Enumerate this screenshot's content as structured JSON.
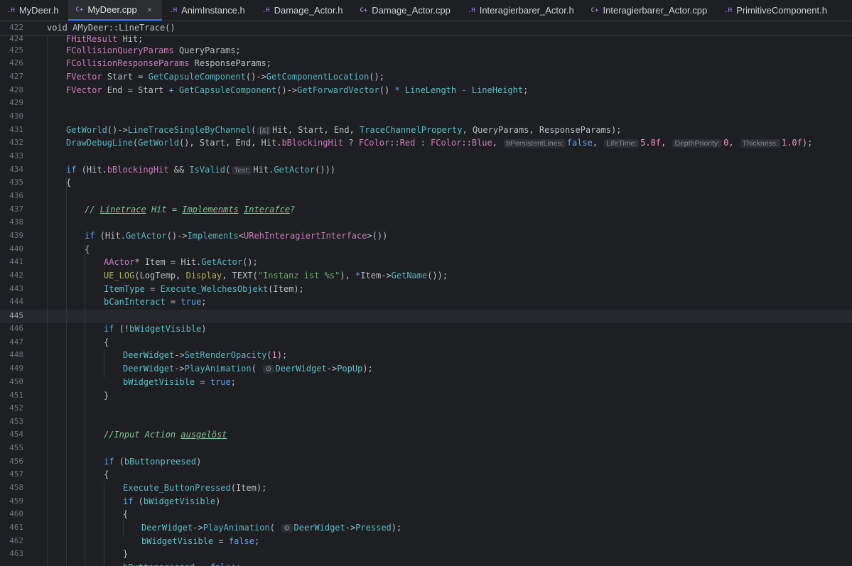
{
  "tabs": [
    {
      "label": "MyDeer.h",
      "icon": ".H",
      "active": false
    },
    {
      "label": "MyDeer.cpp",
      "icon": "C+",
      "active": true
    },
    {
      "label": "AnimInstance.h",
      "icon": ".H",
      "active": false
    },
    {
      "label": "Damage_Actor.h",
      "icon": ".H",
      "active": false
    },
    {
      "label": "Damage_Actor.cpp",
      "icon": "C+",
      "active": false
    },
    {
      "label": "Interagierbarer_Actor.h",
      "icon": ".H",
      "active": false
    },
    {
      "label": "Interagierbarer_Actor.cpp",
      "icon": "C+",
      "active": false
    },
    {
      "label": "PrimitiveComponent.h",
      "icon": ".H",
      "active": false
    }
  ],
  "close_glyph": "×",
  "sticky": {
    "line_number": "422",
    "code": "void AMyDeer::LineTrace()"
  },
  "hints": {
    "ref": "[&]",
    "persistent": "bPersistentLines:",
    "lifetime": "LifeTime:",
    "depth": "DepthPriority:",
    "thickness": "Thickness:",
    "test": "Test:",
    "anim1": "⚙",
    "anim2": "⚙"
  },
  "line_numbers": [
    "424",
    "425",
    "426",
    "427",
    "428",
    "429",
    "430",
    "431",
    "432",
    "433",
    "434",
    "435",
    "436",
    "437",
    "438",
    "439",
    "440",
    "441",
    "442",
    "443",
    "444",
    "445",
    "446",
    "447",
    "448",
    "449",
    "450",
    "451",
    "452",
    "453",
    "454",
    "455",
    "456",
    "457",
    "458",
    "459",
    "460",
    "461",
    "462",
    "463"
  ]
}
